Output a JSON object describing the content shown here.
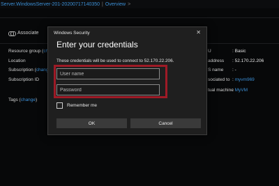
{
  "breadcrumb": {
    "resource": "Server.WindowsServer-201-20200717140350",
    "separator": "|",
    "page": "Overview",
    "chevron": ">"
  },
  "toolbar": {
    "associate_label": "Associate",
    "associate_icon": "link-icon"
  },
  "left_props": {
    "resource_group_label": "Resource group (",
    "resource_group_change": "ch",
    "location_label": "Location",
    "subscription_label": "Subscription (",
    "subscription_change": "change",
    "subscription_id_label": "Subscription ID",
    "tags_label": "Tags (",
    "tags_change": "change",
    "tags_close": ")"
  },
  "right_props": {
    "sku_label": "U",
    "sku_value": ": Basic",
    "address_label": "address",
    "address_value": ": 52.170.22.206",
    "dns_label": "S name",
    "dns_value": ": -",
    "associated_label": "sociated to",
    "associated_value": "myvm969",
    "vm_label": "tual machine",
    "vm_value": "MyVM"
  },
  "dialog": {
    "title": "Windows Security",
    "close_glyph": "✕",
    "heading": "Enter your credentials",
    "message": "These credentials will be used to connect to 52.170.22.206.",
    "username_placeholder": "User name",
    "password_placeholder": "Password",
    "remember_label": "Remember me",
    "ok_label": "OK",
    "cancel_label": "Cancel"
  },
  "colors": {
    "highlight": "#9e1a26",
    "link": "#3b8fd6",
    "dialog_bg": "#1f1f1f"
  }
}
